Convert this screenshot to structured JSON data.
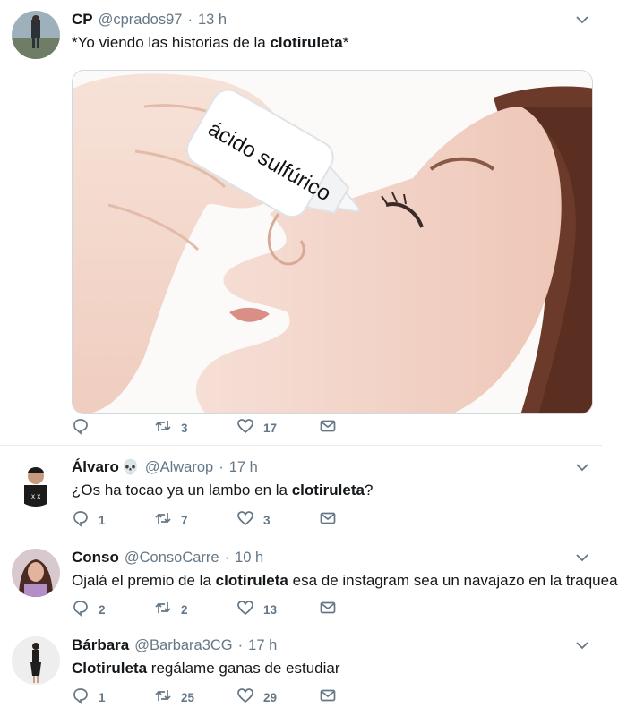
{
  "tweets": [
    {
      "name": "CP",
      "emoji": "",
      "handle": "@cprados97",
      "time": "13 h",
      "text_parts": [
        "*Yo viendo las historias de la ",
        "clotiruleta",
        "*"
      ],
      "media": {
        "label": "ácido sulfúrico"
      },
      "replies": "",
      "retweets": "3",
      "likes": "17"
    },
    {
      "name": "Álvaro",
      "emoji": "💀",
      "handle": "@Alwarop",
      "time": "17 h",
      "text_parts": [
        "¿Os ha tocao ya un lambo en la ",
        "clotiruleta",
        "?"
      ],
      "replies": "1",
      "retweets": "7",
      "likes": "3"
    },
    {
      "name": "Conso",
      "emoji": "",
      "handle": "@ConsoCarre",
      "time": "10 h",
      "text_parts": [
        "Ojalá el premio de la ",
        "clotiruleta",
        " esa de instagram sea un navajazo en la traquea"
      ],
      "replies": "2",
      "retweets": "2",
      "likes": "13"
    },
    {
      "name": "Bárbara",
      "emoji": "",
      "handle": "@Barbara3CG",
      "time": "17 h",
      "text_parts": [
        "",
        "Clotiruleta",
        " regálame ganas de estudiar"
      ],
      "replies": "1",
      "retweets": "25",
      "likes": "29"
    }
  ],
  "separator": "·",
  "icons": {
    "reply": "reply-icon",
    "retweet": "retweet-icon",
    "like": "heart-icon",
    "message": "envelope-icon",
    "more": "chevron-down-icon"
  },
  "colors": {
    "text": "#14171a",
    "secondary": "#657786",
    "divider": "#e6ecf0"
  }
}
